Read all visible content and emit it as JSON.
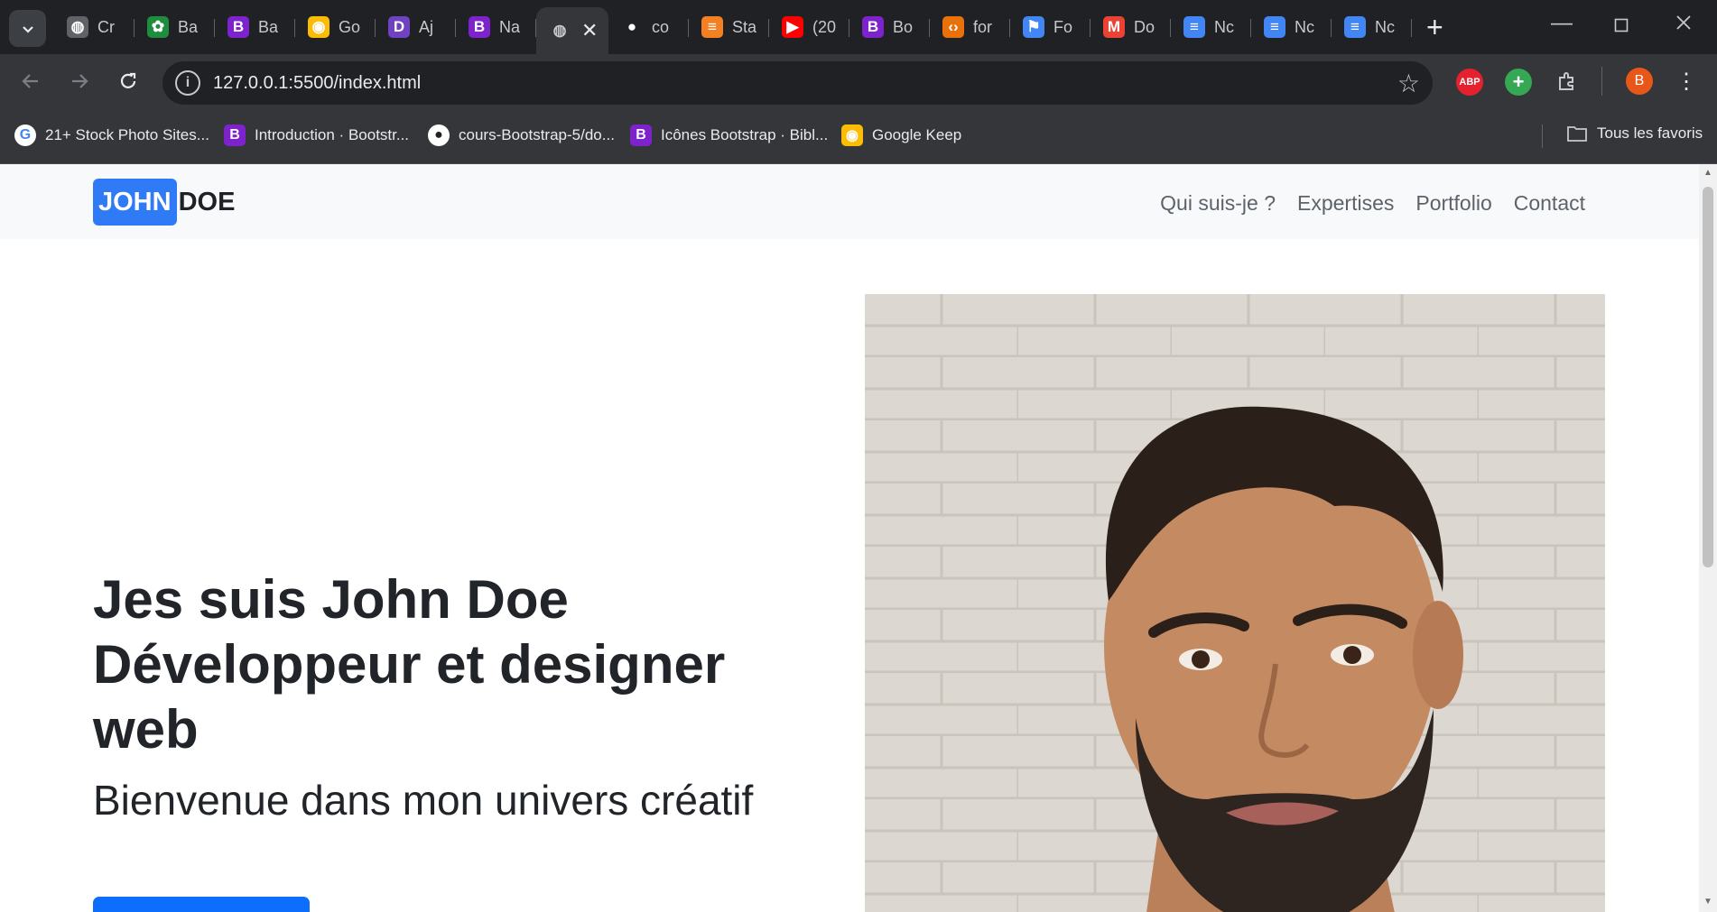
{
  "browser": {
    "tabs": [
      {
        "title": "Cr",
        "icon": "globe-icon",
        "color": "#5f6368",
        "glyph": "◍"
      },
      {
        "title": "Ba",
        "icon": "tree-icon",
        "color": "#1e8e3e",
        "glyph": "✿"
      },
      {
        "title": "Ba",
        "icon": "bootstrap-icon",
        "color": "#7e22ce",
        "glyph": "B"
      },
      {
        "title": "Go",
        "icon": "keep-icon",
        "color": "#fbbc04",
        "glyph": "◉"
      },
      {
        "title": "Aj",
        "icon": "d-icon",
        "color": "#6f42c1",
        "glyph": "D"
      },
      {
        "title": "Na",
        "icon": "bootstrap-icon",
        "color": "#7e22ce",
        "glyph": "B"
      },
      {
        "title": "",
        "icon": "globe-icon",
        "color": "#5f6368",
        "glyph": "◍",
        "active": true
      },
      {
        "title": "co",
        "icon": "github-icon",
        "color": "#202124",
        "glyph": "●"
      },
      {
        "title": "Sta",
        "icon": "stackoverflow-icon",
        "color": "#f48024",
        "glyph": "≡"
      },
      {
        "title": "(20",
        "icon": "youtube-icon",
        "color": "#ff0000",
        "glyph": "▶"
      },
      {
        "title": "Bo",
        "icon": "bootstrap-icon",
        "color": "#7e22ce",
        "glyph": "B"
      },
      {
        "title": "for",
        "icon": "code-icon",
        "color": "#e8710a",
        "glyph": "‹›"
      },
      {
        "title": "Fo",
        "icon": "flag-icon",
        "color": "#4285f4",
        "glyph": "⚑"
      },
      {
        "title": "Do",
        "icon": "gmail-icon",
        "color": "#ea4335",
        "glyph": "M"
      },
      {
        "title": "Nc",
        "icon": "docs-icon",
        "color": "#4285f4",
        "glyph": "≡"
      },
      {
        "title": "Nc",
        "icon": "docs-icon",
        "color": "#4285f4",
        "glyph": "≡"
      },
      {
        "title": "Nc",
        "icon": "docs-icon",
        "color": "#4285f4",
        "glyph": "≡"
      }
    ],
    "address": {
      "url": "127.0.0.1:5500/index.html"
    },
    "profile_initial": "B",
    "extensions": [
      {
        "name": "adblock-plus-icon",
        "label": "ABP",
        "color": "#e5212f"
      },
      {
        "name": "add-extension-icon",
        "label": "+",
        "color": "#34a853"
      }
    ],
    "bookmarks": [
      {
        "label": "21+ Stock Photo Sites...",
        "icon": "google-icon",
        "color": "#ffffff",
        "glyph": "G"
      },
      {
        "label": "Introduction · Bootstr...",
        "icon": "bootstrap-icon",
        "color": "#7e22ce",
        "glyph": "B"
      },
      {
        "label": "cours-Bootstrap-5/do...",
        "icon": "github-icon",
        "color": "#ffffff",
        "glyph": "●"
      },
      {
        "label": "Icônes Bootstrap · Bibl...",
        "icon": "bootstrap-icon",
        "color": "#7e22ce",
        "glyph": "B"
      },
      {
        "label": "Google Keep",
        "icon": "keep-icon",
        "color": "#fbbc04",
        "glyph": "◉"
      }
    ],
    "all_bookmarks": "Tous les favoris"
  },
  "page": {
    "brand": {
      "part1": "JOHN",
      "part2": "DOE"
    },
    "nav": [
      "Qui suis-je ?",
      "Expertises",
      "Portfolio",
      "Contact"
    ],
    "hero": {
      "title": "Jes suis John Doe Développeur et designer web",
      "subtitle": "Bienvenue dans mon univers créatif"
    },
    "colors": {
      "primary": "#0d6efd",
      "navbar_bg": "#f8f9fa"
    }
  }
}
